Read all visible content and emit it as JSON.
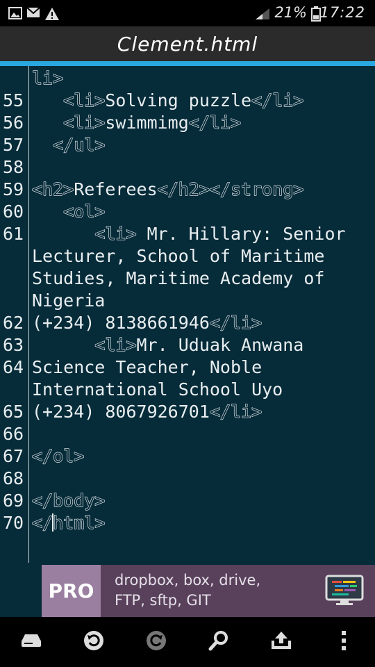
{
  "status_bar": {
    "icons": [
      "image-icon",
      "gmail-icon",
      "warning-icon",
      "signal-icon",
      "battery-icon"
    ],
    "battery_percent": "21%",
    "time": "17:22"
  },
  "title_bar": {
    "title": "Clement.html"
  },
  "colors": {
    "background": "#062b39",
    "title_bar": "#2b2b2b",
    "accent": "#29a8e0",
    "ad_background": "#59415c"
  },
  "editor": {
    "lines": [
      {
        "number": "",
        "segments": [
          {
            "type": "tag",
            "text": "li>"
          }
        ]
      },
      {
        "number": "55",
        "segments": [
          {
            "type": "text",
            "text": "   "
          },
          {
            "type": "tag",
            "text": "<li>"
          },
          {
            "type": "text",
            "text": "Solving puzzle"
          },
          {
            "type": "tag",
            "text": "</li>"
          }
        ]
      },
      {
        "number": "56",
        "segments": [
          {
            "type": "text",
            "text": "   "
          },
          {
            "type": "tag",
            "text": "<li>"
          },
          {
            "type": "text",
            "text": "swimmimg"
          },
          {
            "type": "tag",
            "text": "</li>"
          }
        ]
      },
      {
        "number": "57",
        "segments": [
          {
            "type": "text",
            "text": "  "
          },
          {
            "type": "tag",
            "text": "</ul>"
          }
        ]
      },
      {
        "number": "58",
        "segments": []
      },
      {
        "number": "59",
        "segments": [
          {
            "type": "tag",
            "text": "<h2>"
          },
          {
            "type": "text",
            "text": "Referees"
          },
          {
            "type": "tag",
            "text": "</h2></strong>"
          }
        ]
      },
      {
        "number": "60",
        "segments": [
          {
            "type": "text",
            "text": "   "
          },
          {
            "type": "tag",
            "text": "<ol>"
          }
        ]
      },
      {
        "number": "61",
        "segments": [
          {
            "type": "text",
            "text": "      "
          },
          {
            "type": "tag",
            "text": "<li>"
          },
          {
            "type": "text",
            "text": " Mr. Hillary: Senior"
          }
        ]
      },
      {
        "number": "",
        "segments": [
          {
            "type": "text",
            "text": "Lecturer, School of Maritime"
          }
        ]
      },
      {
        "number": "",
        "segments": [
          {
            "type": "text",
            "text": "Studies, Maritime Academy of"
          }
        ]
      },
      {
        "number": "",
        "segments": [
          {
            "type": "text",
            "text": "Nigeria"
          }
        ]
      },
      {
        "number": "62",
        "segments": [
          {
            "type": "text",
            "text": "(+234) 8138661946"
          },
          {
            "type": "tag",
            "text": "</li>"
          }
        ]
      },
      {
        "number": "63",
        "segments": [
          {
            "type": "text",
            "text": "      "
          },
          {
            "type": "tag",
            "text": "<li>"
          },
          {
            "type": "text",
            "text": "Mr. Uduak Anwana"
          }
        ]
      },
      {
        "number": "64",
        "segments": [
          {
            "type": "text",
            "text": "Science Teacher, Noble"
          }
        ]
      },
      {
        "number": "",
        "segments": [
          {
            "type": "text",
            "text": "International School Uyo"
          }
        ]
      },
      {
        "number": "65",
        "segments": [
          {
            "type": "text",
            "text": "(+234) 8067926701"
          },
          {
            "type": "tag",
            "text": "</li>"
          }
        ]
      },
      {
        "number": "66",
        "segments": []
      },
      {
        "number": "67",
        "segments": [
          {
            "type": "tag",
            "text": "</ol>"
          }
        ]
      },
      {
        "number": "68",
        "segments": []
      },
      {
        "number": "69",
        "segments": [
          {
            "type": "tag",
            "text": "</body>"
          }
        ]
      },
      {
        "number": "70",
        "segments": [
          {
            "type": "tag",
            "text": "</"
          },
          {
            "type": "cursor",
            "text": ""
          },
          {
            "type": "tag",
            "text": "html>"
          }
        ]
      }
    ]
  },
  "ad": {
    "badge": "PRO",
    "line1": "dropbox, box, drive,",
    "line2": "FTP, sftp, GIT",
    "icon": "monitor-code-icon"
  },
  "bottom_bar": {
    "buttons": [
      {
        "name": "storage-button",
        "icon": "drive-icon"
      },
      {
        "name": "undo-button",
        "icon": "undo-icon"
      },
      {
        "name": "redo-button",
        "icon": "redo-icon"
      },
      {
        "name": "search-button",
        "icon": "search-icon"
      },
      {
        "name": "upload-button",
        "icon": "upload-icon"
      },
      {
        "name": "more-button",
        "icon": "more-vertical-icon"
      }
    ]
  }
}
